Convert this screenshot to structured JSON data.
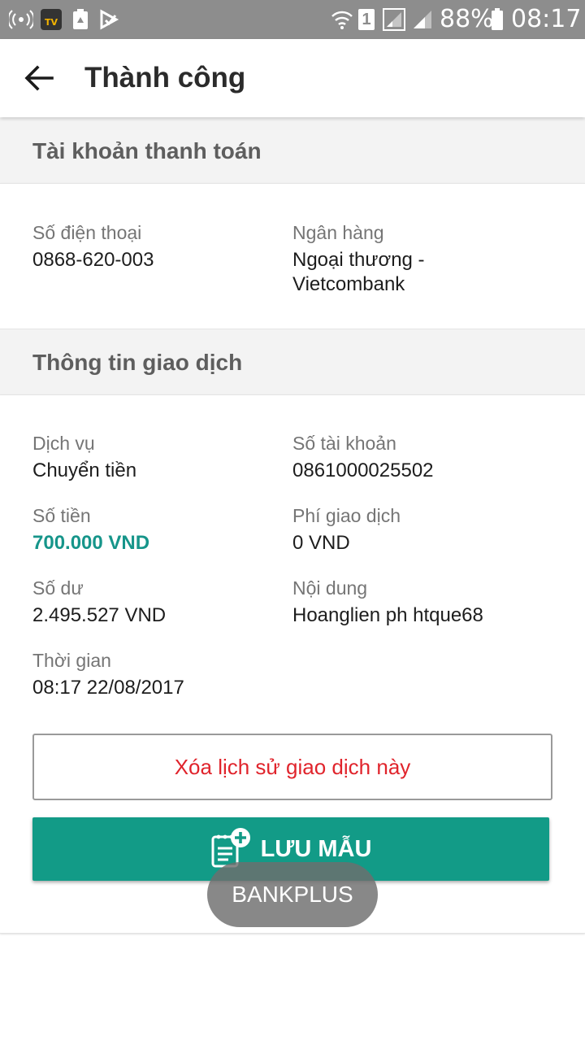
{
  "status_bar": {
    "battery_percent": "88%",
    "time": "08:17",
    "sim_slot": "1",
    "icons": [
      "wifi-calling-icon",
      "tv-app-icon",
      "recycle-icon",
      "play-store-icon",
      "wifi-icon",
      "sim-1-icon",
      "signal-1-icon",
      "signal-2-icon",
      "battery-icon"
    ]
  },
  "app_bar": {
    "title": "Thành công",
    "back_icon": "arrow-left-icon"
  },
  "payment_account": {
    "section_title": "Tài khoản thanh toán",
    "phone_label": "Số điện thoại",
    "phone_value": "0868-620-003",
    "bank_label": "Ngân hàng",
    "bank_value_line1": "Ngoại thương -",
    "bank_value_line2": "Vietcombank"
  },
  "transaction": {
    "section_title": "Thông tin giao dịch",
    "service_label": "Dịch vụ",
    "service_value": "Chuyển tiền",
    "account_label": "Số tài khoản",
    "account_value": "0861000025502",
    "amount_label": "Số tiền",
    "amount_value": "700.000 VND",
    "fee_label": "Phí giao dịch",
    "fee_value": "0 VND",
    "balance_label": "Số dư",
    "balance_value": "2.495.527 VND",
    "content_label": "Nội dung",
    "content_value": "Hoanglien ph htque68",
    "time_label": "Thời gian",
    "time_value": "08:17 22/08/2017"
  },
  "actions": {
    "delete_label": "Xóa lịch sử giao dịch này",
    "save_label": "LƯU MẪU",
    "save_icon": "add-template-icon"
  },
  "toast": {
    "text": "BANKPLUS"
  },
  "colors": {
    "status_bar": "#8d8d8d",
    "accent": "#129b87",
    "amount": "#16958a",
    "delete_text": "#e0242c",
    "section_bg": "#f3f3f3"
  }
}
